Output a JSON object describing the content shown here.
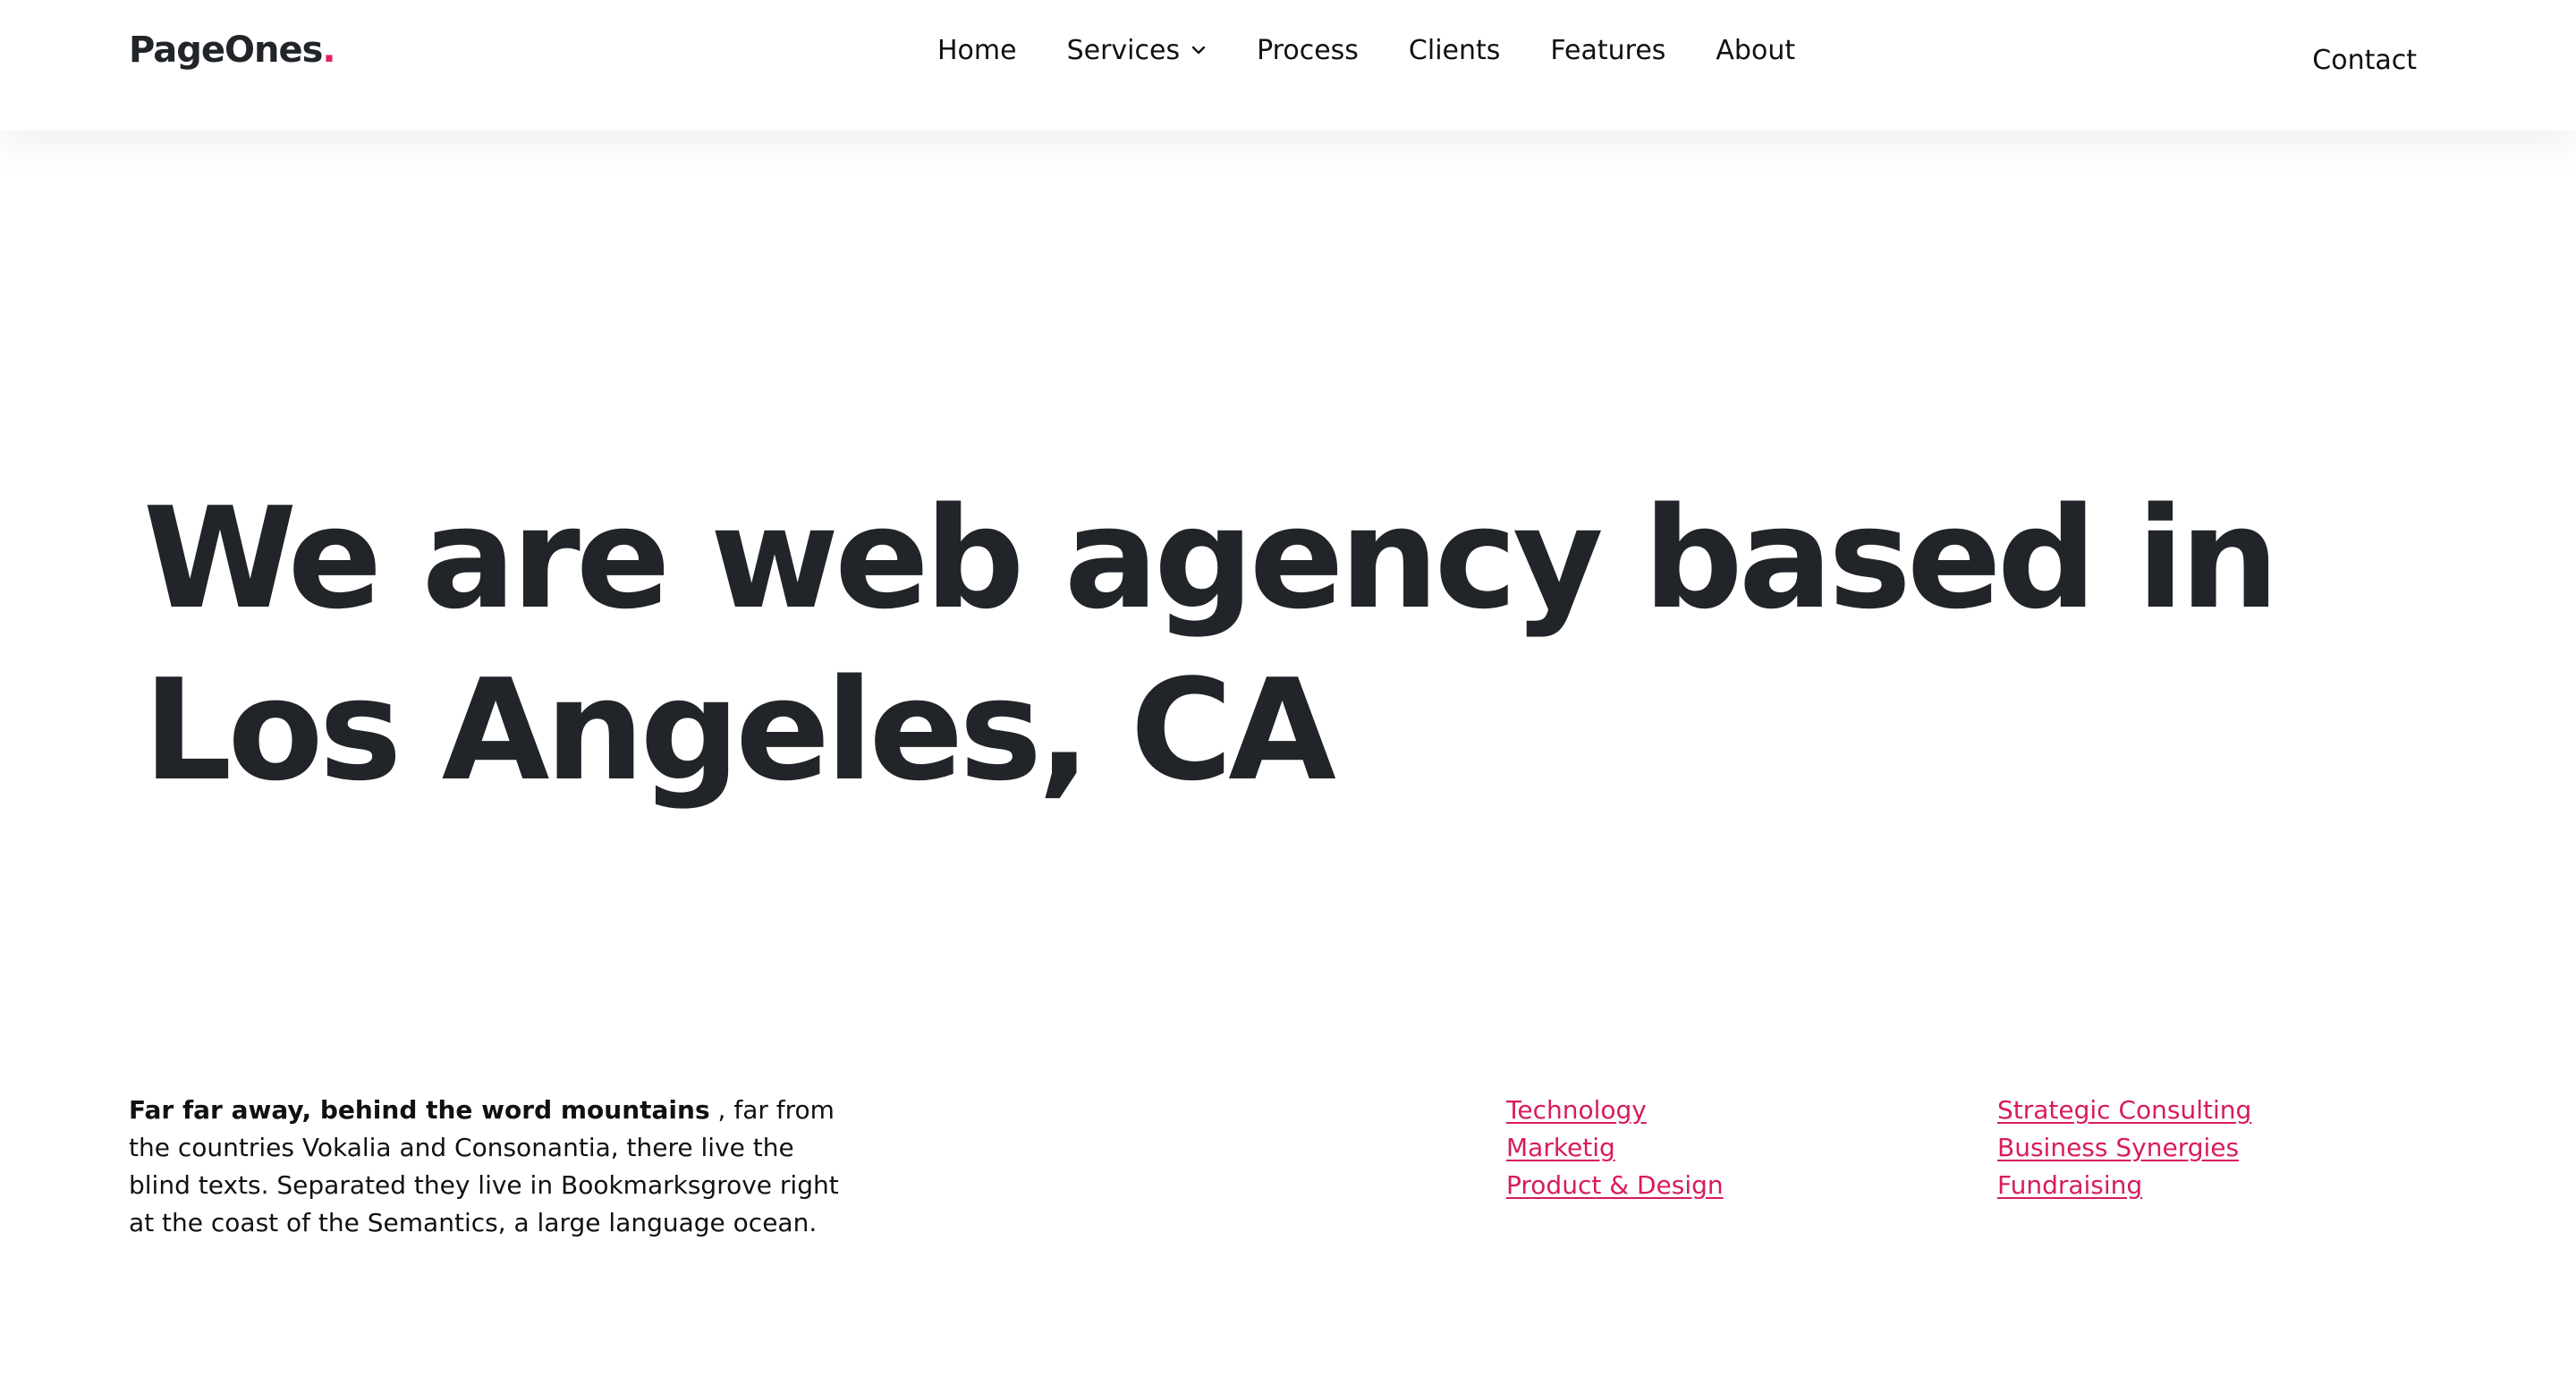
{
  "brand": {
    "name": "PageOnes",
    "dot": ".",
    "accent_color": "#e0245e"
  },
  "nav": {
    "items": [
      {
        "label": "Home"
      },
      {
        "label": "Services",
        "has_dropdown": true,
        "icon": "chevron-down-icon"
      },
      {
        "label": "Process"
      },
      {
        "label": "Clients"
      },
      {
        "label": "Features"
      },
      {
        "label": "About"
      }
    ],
    "contact_label": "Contact"
  },
  "hero": {
    "line1": "We are web agency based in",
    "line2": "Los Angeles, CA"
  },
  "intro": {
    "bold": "Far far away, behind the word mountains",
    "rest": " , far from the countries Vokalia and Consonantia, there live the blind texts. Separated they live in Bookmarksgrove right at the coast of the Semantics, a large language ocean."
  },
  "links": {
    "color": "#d81b60",
    "column1": [
      "Technology",
      "Marketig",
      "Product & Design"
    ],
    "column2": [
      "Strategic Consulting",
      "Business Synergies",
      "Fundraising"
    ]
  }
}
